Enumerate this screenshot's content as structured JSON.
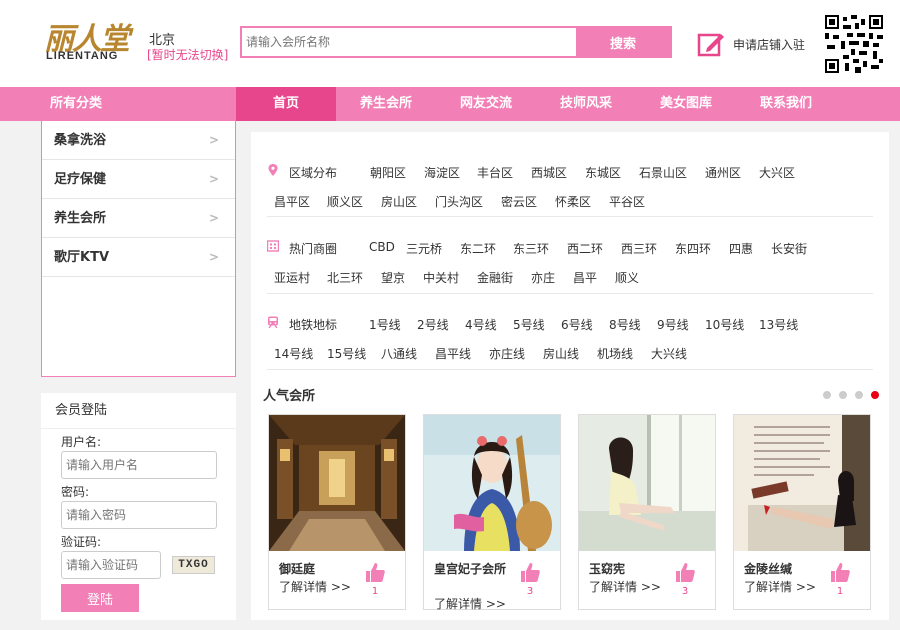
{
  "header": {
    "logo_cn": "丽人堂",
    "logo_en": "LIRENTANG",
    "city": "北京",
    "city_note": "[暂时无法切换]",
    "search_placeholder": "请输入会所名称",
    "search_button": "搜索",
    "apply_text": "申请店铺入驻"
  },
  "nav": {
    "all_categories": "所有分类",
    "items": [
      "首页",
      "养生会所",
      "网友交流",
      "技师风采",
      "美女图库",
      "联系我们"
    ]
  },
  "categories": [
    "桑拿洗浴",
    "足疗保健",
    "养生会所",
    "歌厅KTV"
  ],
  "login": {
    "title": "会员登陆",
    "username_label": "用户名:",
    "username_placeholder": "请输入用户名",
    "password_label": "密码:",
    "password_placeholder": "请输入密码",
    "captcha_label": "验证码:",
    "captcha_placeholder": "请输入验证码",
    "captcha_code": "TXGO",
    "submit": "登陆"
  },
  "filters": {
    "region": {
      "title": "区域分布",
      "items": [
        "朝阳区",
        "海淀区",
        "丰台区",
        "西城区",
        "东城区",
        "石景山区",
        "通州区",
        "大兴区",
        "昌平区",
        "顺义区",
        "房山区",
        "门头沟区",
        "密云区",
        "怀柔区",
        "平谷区"
      ]
    },
    "business": {
      "title": "热门商圈",
      "items": [
        "CBD",
        "三元桥",
        "东二环",
        "东三环",
        "西二环",
        "西三环",
        "东四环",
        "四惠",
        "长安街",
        "亚运村",
        "北三环",
        "望京",
        "中关村",
        "金融街",
        "亦庄",
        "昌平",
        "顺义"
      ]
    },
    "subway": {
      "title": "地铁地标",
      "items": [
        "1号线",
        "2号线",
        "4号线",
        "5号线",
        "6号线",
        "8号线",
        "9号线",
        "10号线",
        "13号线",
        "14号线",
        "15号线",
        "八通线",
        "昌平线",
        "亦庄线",
        "房山线",
        "机场线",
        "大兴线"
      ]
    }
  },
  "popular": {
    "title": "人气会所",
    "cards": [
      {
        "name": "御廷庭",
        "more": "了解详情 >>",
        "likes": "1",
        "image": "interior-photo"
      },
      {
        "name": "皇宫妃子会所",
        "more": "了解详情 >>",
        "likes": "3",
        "image": "costume-illustration"
      },
      {
        "name": "玉窈宪",
        "more": "了解详情 >>",
        "likes": "3",
        "image": "window-photo"
      },
      {
        "name": "金陵丝缄",
        "more": "了解详情 >>",
        "likes": "1",
        "image": "poster-photo"
      }
    ]
  },
  "colors": {
    "accent": "#f27fb6",
    "accent_dark": "#e8468c"
  }
}
